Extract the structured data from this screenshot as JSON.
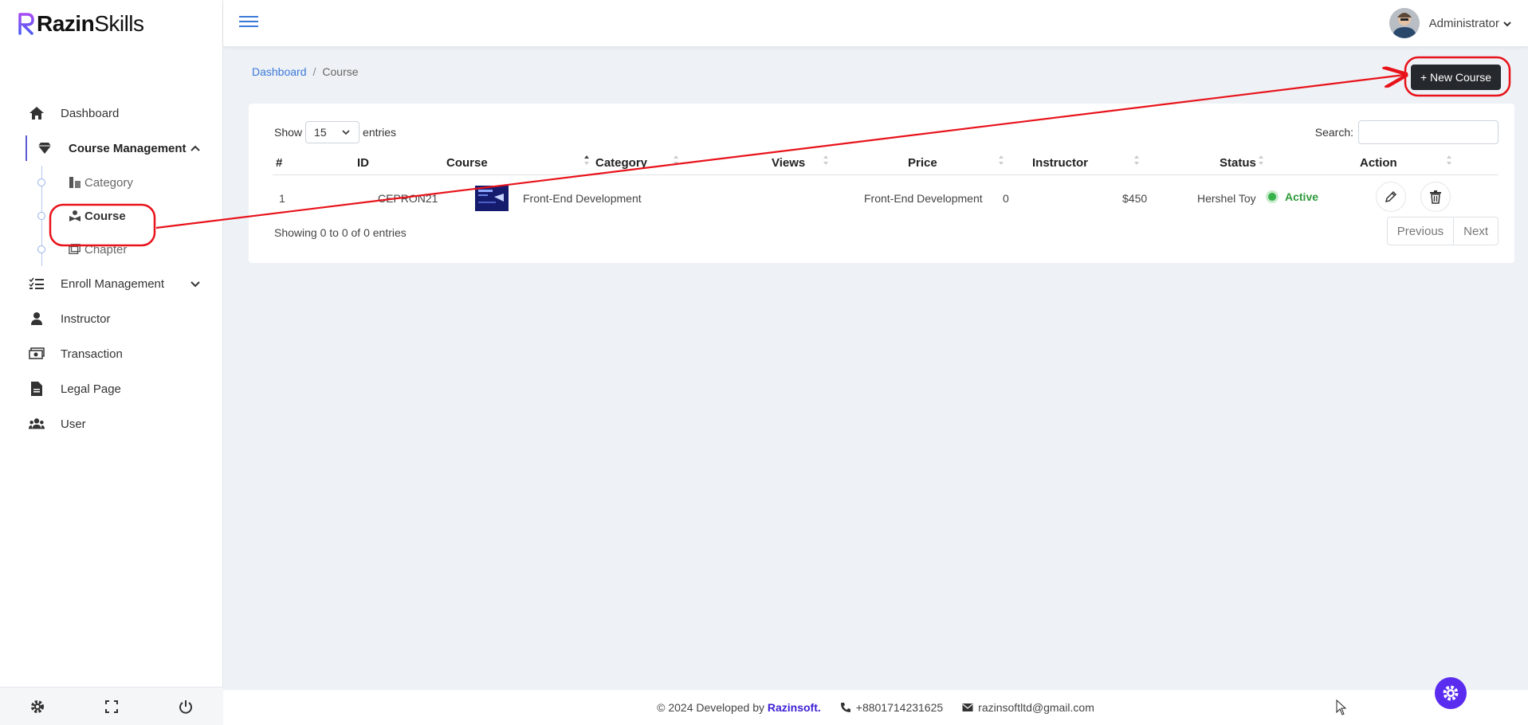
{
  "brand": {
    "bold": "Razin",
    "regular": "Skills"
  },
  "sidebar": {
    "items": [
      {
        "label": "Dashboard",
        "icon": "home-icon"
      },
      {
        "label": "Course Management",
        "icon": "gem-icon",
        "open": true,
        "children": [
          {
            "label": "Category",
            "icon": "category-icon"
          },
          {
            "label": "Course",
            "icon": "course-icon",
            "active": true
          },
          {
            "label": "Chapter",
            "icon": "chapter-icon"
          }
        ]
      },
      {
        "label": "Enroll Management",
        "icon": "list-check-icon"
      },
      {
        "label": "Instructor",
        "icon": "person-icon"
      },
      {
        "label": "Transaction",
        "icon": "money-icon"
      },
      {
        "label": "Legal Page",
        "icon": "file-icon"
      },
      {
        "label": "User",
        "icon": "users-icon"
      }
    ]
  },
  "topbar": {
    "user_name": "Administrator"
  },
  "breadcrumb": {
    "home": "Dashboard",
    "separator": "/",
    "current": "Course"
  },
  "new_course_label": "+ New Course",
  "table": {
    "show_label": "Show",
    "entries_value": "15",
    "entries_label": "entries",
    "search_label": "Search:",
    "columns": [
      "#",
      "ID",
      "Course",
      "Category",
      "Views",
      "Price",
      "Instructor",
      "Status",
      "Action"
    ],
    "rows": [
      {
        "num": "1",
        "id": "CEPRON21",
        "course": "Front-End Development",
        "category": "Front-End Development",
        "views": "0",
        "price": "$450",
        "instructor": "Hershel Toy",
        "status": "Active"
      }
    ],
    "info": "Showing 0 to 0 of 0 entries",
    "prev": "Previous",
    "next": "Next"
  },
  "footer": {
    "copyright": "© 2024 Developed by",
    "company": "Razinsoft.",
    "phone": "+8801714231625",
    "email": "razinsoftltd@gmail.com"
  },
  "colors": {
    "accent": "#5a2cf0",
    "annotation_red": "#e8121a",
    "status_green": "#2e9a3a",
    "link_blue": "#3a79d9"
  }
}
